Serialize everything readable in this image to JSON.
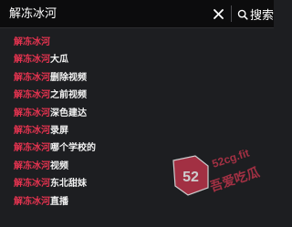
{
  "search": {
    "query": "解冻冰河",
    "button_label": "搜索"
  },
  "suggestions": [
    {
      "highlight": "解冻冰河",
      "rest": ""
    },
    {
      "highlight": "解冻冰河",
      "rest": "大瓜"
    },
    {
      "highlight": "解冻冰河",
      "rest": "删除视频"
    },
    {
      "highlight": "解冻冰河",
      "rest": "之前视频"
    },
    {
      "highlight": "解冻冰河",
      "rest": "深色建达"
    },
    {
      "highlight": "解冻冰河",
      "rest": "录屏"
    },
    {
      "highlight": "解冻冰河",
      "rest": "哪个学校的"
    },
    {
      "highlight": "解冻冰河",
      "rest": "视频"
    },
    {
      "highlight": "解冻冰河",
      "rest": "东北甜妹"
    },
    {
      "highlight": "解冻冰河",
      "rest": "直播"
    }
  ],
  "watermark": {
    "badge": "52",
    "site": "52cg.fit",
    "name": "吾爱吃瓜"
  },
  "colors": {
    "background": "#1d1e21",
    "search_bar": "#0c0c0d",
    "highlight": "#e2334f",
    "text": "#f2f2f2",
    "watermark": "#c8364d"
  },
  "icons": {
    "clear": "close-icon",
    "search": "search-icon"
  }
}
